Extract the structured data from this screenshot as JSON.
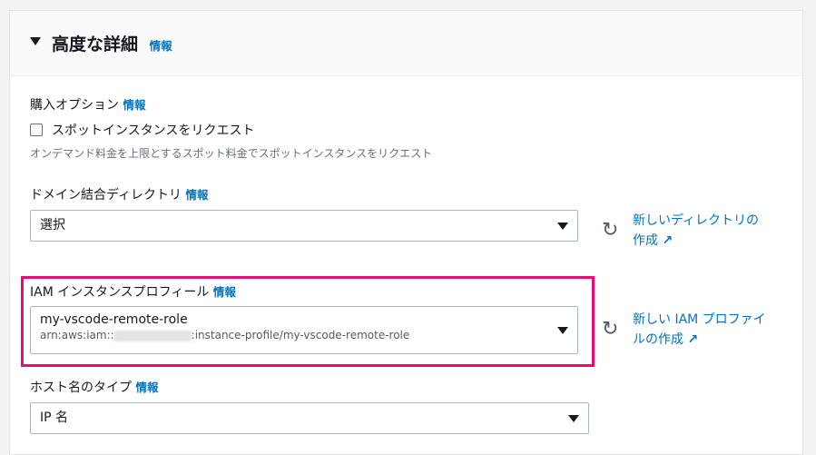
{
  "section": {
    "title": "高度な詳細",
    "info": "情報"
  },
  "purchase": {
    "label": "購入オプション",
    "info": "情報",
    "checkbox_label": "スポットインスタンスをリクエスト",
    "description": "オンデマンド料金を上限とするスポット料金でスポットインスタンスをリクエスト"
  },
  "domain": {
    "label": "ドメイン結合ディレクトリ",
    "info": "情報",
    "value": "選択",
    "link_line1": "新しいディレクトリの",
    "link_line2": "作成"
  },
  "iam": {
    "label": "IAM インスタンスプロフィール",
    "info": "情報",
    "value": "my-vscode-remote-role",
    "arn_prefix": "arn:aws:iam::",
    "arn_suffix": ":instance-profile/my-vscode-remote-role",
    "link_line1": "新しい IAM プロファイ",
    "link_line2": "ルの作成"
  },
  "hostname": {
    "label": "ホスト名のタイプ",
    "info": "情報",
    "value": "IP 名"
  }
}
